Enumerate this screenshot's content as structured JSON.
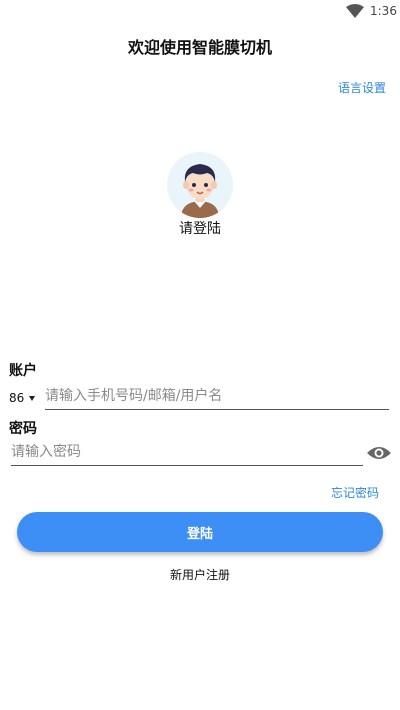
{
  "status_bar": {
    "time": "1:36",
    "wifi_icon": "wifi-icon"
  },
  "header": {
    "title": "欢迎使用智能膜切机",
    "language_link": "语言设置"
  },
  "avatar": {
    "icon": "user-avatar-icon",
    "prompt": "请登陆"
  },
  "account": {
    "label": "账户",
    "country_code": "86",
    "placeholder": "请输入手机号码/邮箱/用户名",
    "value": ""
  },
  "password": {
    "label": "密码",
    "placeholder": "请输入密码",
    "value": "",
    "toggle_icon": "eye-icon"
  },
  "forgot_link": "忘记密码",
  "login_button": "登陆",
  "register_link": "新用户注册",
  "colors": {
    "accent": "#3d8ff5",
    "link": "#2e86de"
  }
}
